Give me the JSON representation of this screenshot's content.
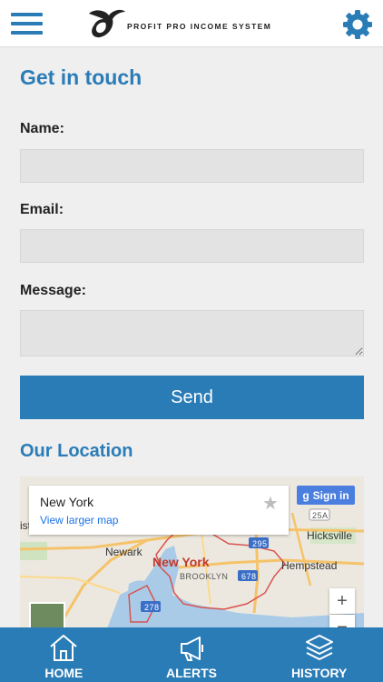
{
  "header": {
    "logo_text": "PROFIT PRO INCOME SYSTEM",
    "menu_icon": "hamburger-icon",
    "settings_icon": "gear-icon"
  },
  "contact": {
    "title": "Get in touch",
    "name_label": "Name:",
    "name_value": "",
    "email_label": "Email:",
    "email_value": "",
    "message_label": "Message:",
    "message_value": "",
    "send_label": "Send"
  },
  "location": {
    "title": "Our Location",
    "map_place": "New York",
    "map_link": "View larger map",
    "signin_label": "Sign in",
    "zoom_in": "+",
    "zoom_out": "−",
    "map_labels": {
      "newark": "Newark",
      "new_york": "New York",
      "brooklyn": "BROOKLYN",
      "hicksville": "Hicksville",
      "hempstead": "Hempstead",
      "ist": "ist",
      "r295": "295",
      "r25a": "25A",
      "r278": "278",
      "r678": "678"
    }
  },
  "nav": {
    "home_label": "HOME",
    "alerts_label": "ALERTS",
    "history_label": "HISTORY"
  },
  "colors": {
    "accent": "#2a7cb7",
    "field_bg": "#e3e3e3",
    "page_bg": "#efefef"
  }
}
